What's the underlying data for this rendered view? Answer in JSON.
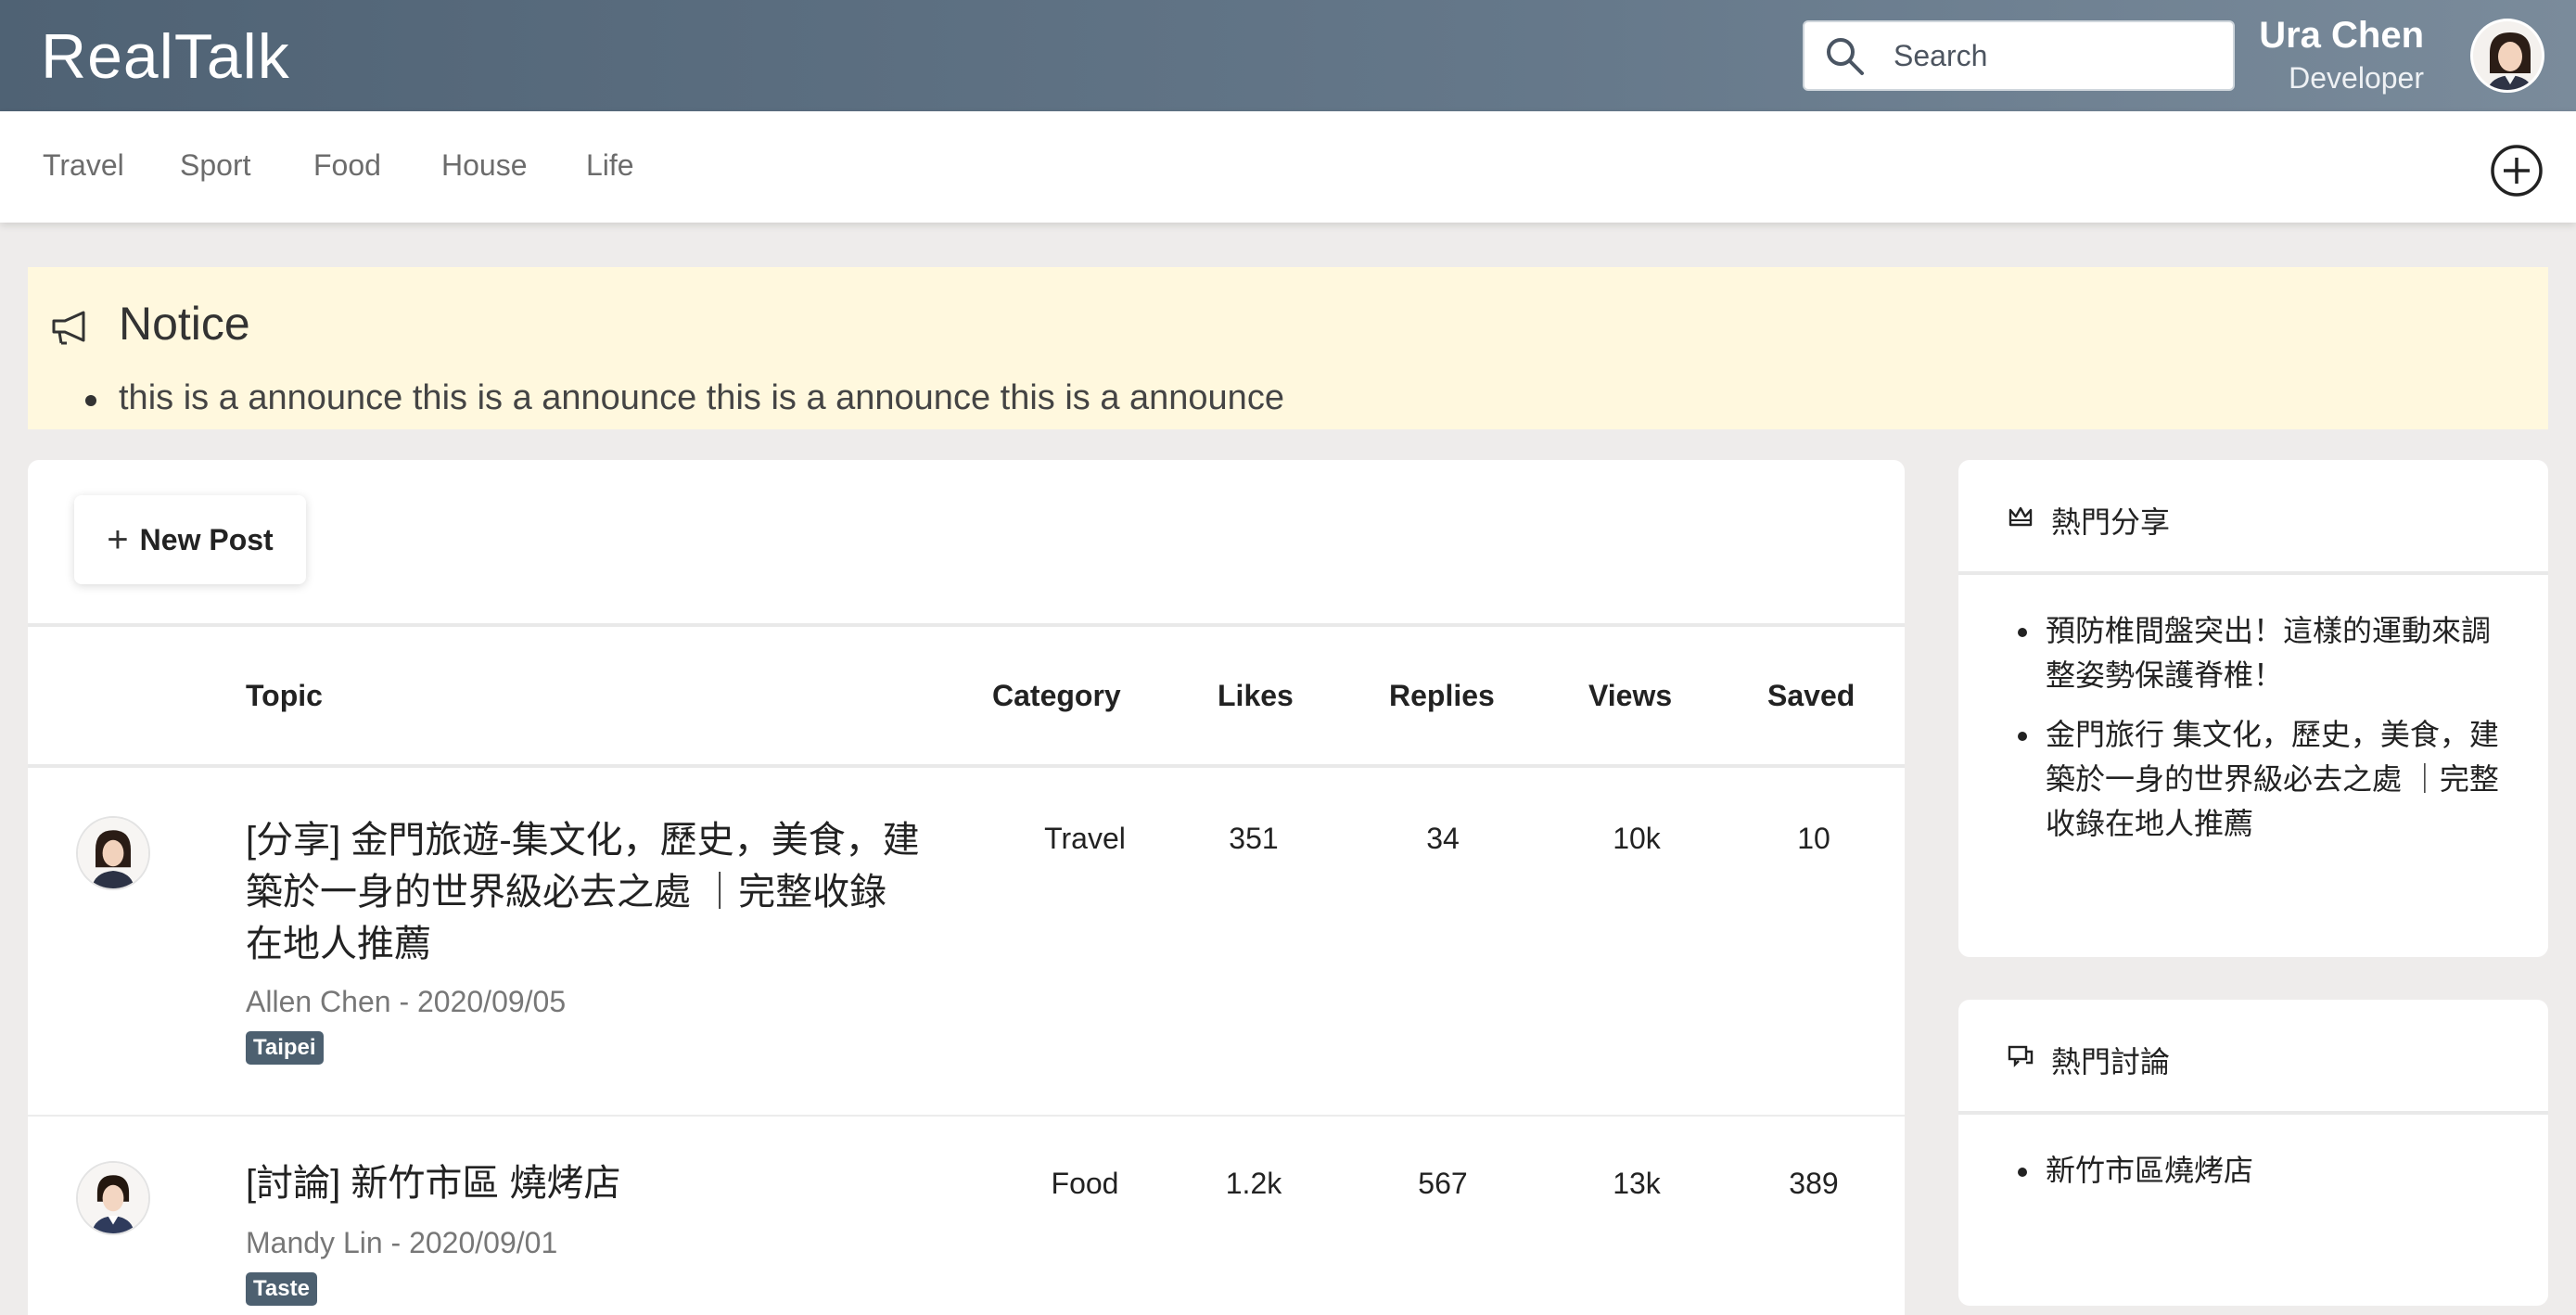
{
  "header": {
    "brand": "RealTalk",
    "search_placeholder": "Search",
    "user": {
      "name": "Ura Chen",
      "role": "Developer"
    }
  },
  "nav": {
    "items": [
      "Travel",
      "Sport",
      "Food",
      "House",
      "Life"
    ]
  },
  "notice": {
    "title": "Notice",
    "items": [
      "this is a announce this is a announce this is a announce this is a announce"
    ]
  },
  "main": {
    "new_post_label": "New Post",
    "columns": [
      "Topic",
      "Category",
      "Likes",
      "Replies",
      "Views",
      "Saved"
    ],
    "posts": [
      {
        "title_lines": [
          "[分享] 金門旅遊-集文化，歷史，美食，建",
          "築於一身的世界級必去之處 ｜完整收錄",
          "在地人推薦"
        ],
        "meta": "Allen Chen - 2020/09/05",
        "tag": "Taipei",
        "category": "Travel",
        "likes": "351",
        "replies": "34",
        "views": "10k",
        "saved": "10"
      },
      {
        "title_lines": [
          "[討論] 新竹市區 燒烤店"
        ],
        "meta": "Mandy Lin - 2020/09/01",
        "tag": "Taste",
        "category": "Food",
        "likes": "1.2k",
        "replies": "567",
        "views": "13k",
        "saved": "389"
      }
    ]
  },
  "sidebar": {
    "hot_shares": {
      "title": "熱門分享",
      "items": [
        "預防椎間盤突出！這樣的運動來調整姿勢保護脊椎！",
        "金門旅行 集文化，歷史，美食，建築於一身的世界級必去之處 ｜完整收錄在地人推薦"
      ]
    },
    "hot_discussions": {
      "title": "熱門討論",
      "items": [
        "新竹市區燒烤店"
      ]
    }
  },
  "colors": {
    "header_gradient_start": "#4f6274",
    "header_gradient_end": "#7a8b9b",
    "notice_bg": "#fff8de",
    "tag_bg": "#4d6070",
    "page_bg": "#eeeceb"
  }
}
